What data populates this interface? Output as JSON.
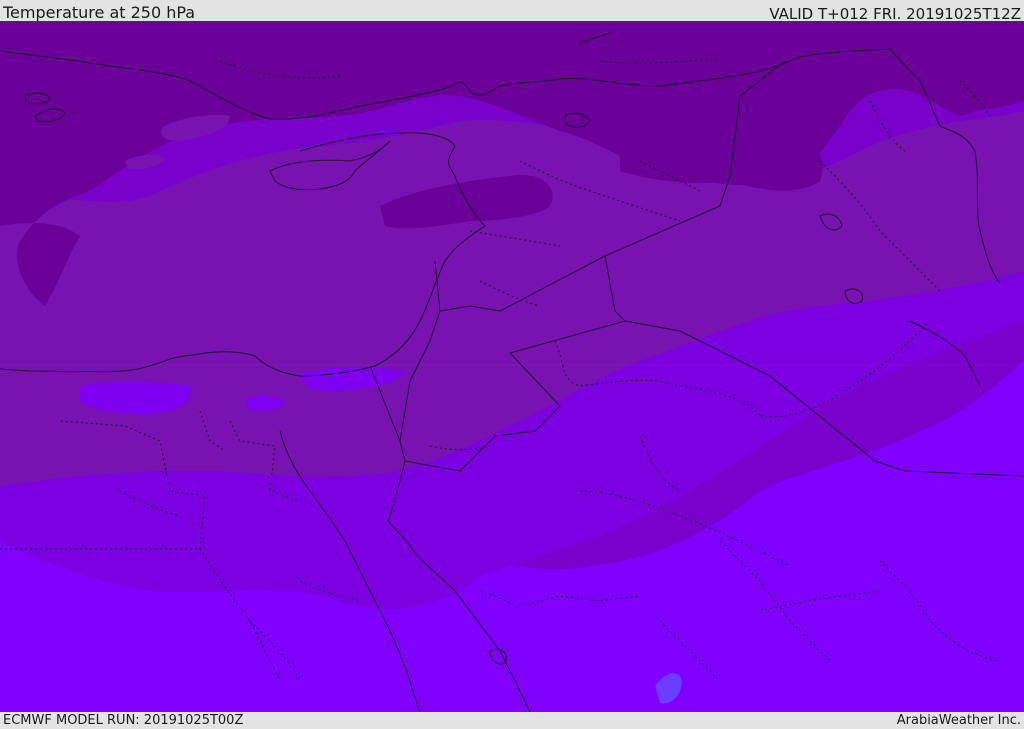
{
  "header": {
    "title": "Temperature at 250 hPa",
    "valid": "VALID T+012 FRI. 20191025T12Z"
  },
  "footer": {
    "model_run": "ECMWF MODEL RUN: 20191025T00Z",
    "credit": "ArabiaWeather Inc."
  },
  "map": {
    "field": "temperature",
    "level": "250 hPa",
    "region": "Eastern Mediterranean / Middle East",
    "color_bands": [
      {
        "name": "coldest",
        "color": "#6b0099"
      },
      {
        "name": "cold",
        "color": "#7812b0"
      },
      {
        "name": "mid",
        "color": "#7a00cc"
      },
      {
        "name": "warm",
        "color": "#7f00f0"
      },
      {
        "name": "warmest",
        "color": "#7f00ff"
      },
      {
        "name": "spot",
        "color": "#6a3dff"
      }
    ],
    "line_colors": {
      "coastline": "#1a1a2e",
      "border": "#1a1a2e"
    }
  }
}
